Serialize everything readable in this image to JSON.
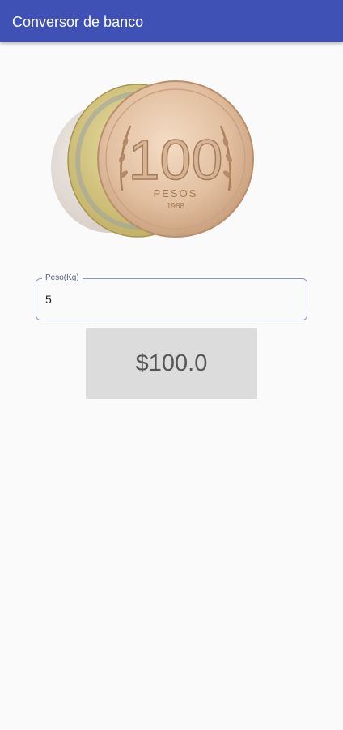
{
  "app_bar": {
    "title": "Conversor de banco",
    "color": "#3f51b5"
  },
  "coin_image": {
    "icon": "peso-coins-image",
    "coin_text": "100",
    "coin_sub": "PESOS",
    "coin_year": "1988"
  },
  "weight_field": {
    "label": "Peso(Kg)",
    "value": "5"
  },
  "result": {
    "text": "$100.0"
  }
}
